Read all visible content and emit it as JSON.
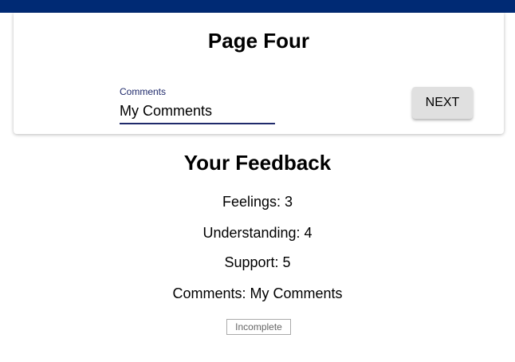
{
  "page": {
    "title": "Page Four"
  },
  "form": {
    "comments_label": "Comments",
    "comments_value": "My Comments",
    "next_label": "NEXT"
  },
  "feedback": {
    "title": "Your Feedback",
    "feelings": "Feelings: 3",
    "understanding": "Understanding: 4",
    "support": "Support: 5",
    "comments": "Comments: My Comments"
  },
  "status": {
    "label": "Incomplete"
  },
  "colors": {
    "top_bar": "#002a74",
    "accent": "#1f2a6b",
    "button_bg": "#e0e0e0"
  }
}
